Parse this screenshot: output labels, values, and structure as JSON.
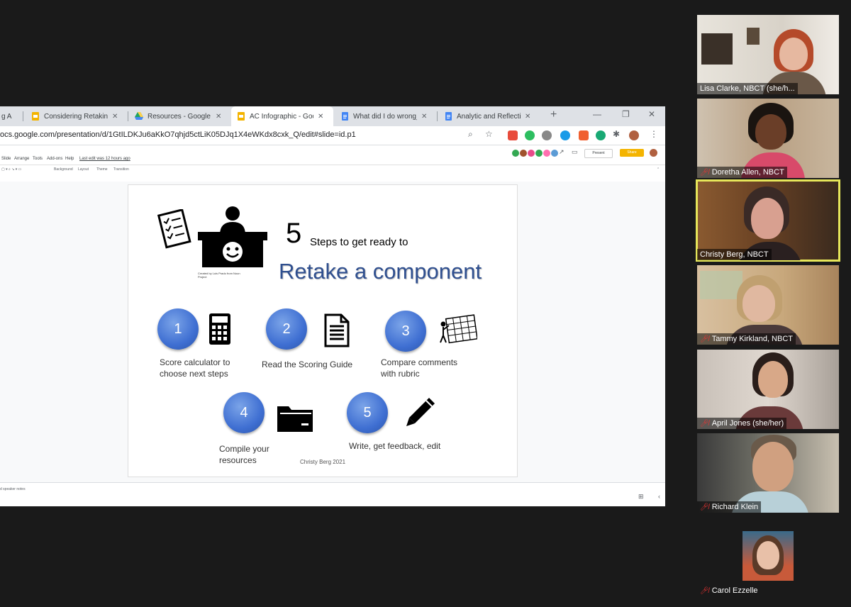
{
  "browser": {
    "tabs": [
      {
        "title": "Considering Retaking a",
        "icon": "slides-icon"
      },
      {
        "title": "Resources - Google Dri",
        "icon": "drive-icon"
      },
      {
        "title": "AC Infographic - Goog",
        "icon": "slides-icon"
      },
      {
        "title": "What did I do wrong_ -",
        "icon": "docs-icon"
      },
      {
        "title": "Analytic and Reflective",
        "icon": "docs-icon"
      }
    ],
    "new_tab": "+",
    "url": "ocs.google.com/presentation/d/1GtILDKJu6aKkO7qhjd5ctLiK05DJq1X4eWKdx8cxk_Q/edit#slide=id.p1"
  },
  "slides_app": {
    "menu": [
      "Slide",
      "Arrange",
      "Tools",
      "Add-ons",
      "Help"
    ],
    "last_edit": "Last edit was 12 hours ago",
    "present_label": "Present",
    "share_label": "Share",
    "toolbar": [
      "Background",
      "Layout",
      "Theme",
      "Transition"
    ],
    "notes_label": "d speaker notes"
  },
  "slide": {
    "title_number": "5",
    "title_sub": "Steps to get ready to",
    "title_main": "Retake a component",
    "credit": "Created by Luis Prado from Noun Project",
    "steps": [
      {
        "num": "1",
        "line1": "Score calculator to",
        "line2": "choose next steps",
        "icon": "calculator-icon"
      },
      {
        "num": "2",
        "line1": "Read the Scoring Guide",
        "line2": "",
        "icon": "document-icon"
      },
      {
        "num": "3",
        "line1": "Compare comments",
        "line2": "with rubric",
        "icon": "rubric-icon"
      },
      {
        "num": "4",
        "line1": "Compile your",
        "line2": "resources",
        "icon": "folder-icon"
      },
      {
        "num": "5",
        "line1": "Write, get feedback, edit",
        "line2": "",
        "icon": "pencil-icon"
      }
    ],
    "footer": "Christy Berg 2021"
  },
  "participants": [
    {
      "name": "Lisa Clarke, NBCT (she/h...",
      "muted": false,
      "speaking": false
    },
    {
      "name": "Doretha Allen, NBCT",
      "muted": true,
      "speaking": false
    },
    {
      "name": "Christy Berg, NBCT",
      "muted": false,
      "speaking": true
    },
    {
      "name": "Tammy Kirkland, NBCT",
      "muted": true,
      "speaking": false
    },
    {
      "name": "April Jones (she/her)",
      "muted": true,
      "speaking": false
    },
    {
      "name": "Richard Klein",
      "muted": true,
      "speaking": false
    },
    {
      "name": "Carol Ezzelle",
      "muted": true,
      "speaking": false
    }
  ],
  "colors": {
    "speaking_border": "#e6e65a",
    "muted_icon": "#e33333",
    "circle_blue": "#3f6fd2",
    "title_blue": "#2f4f8f"
  }
}
